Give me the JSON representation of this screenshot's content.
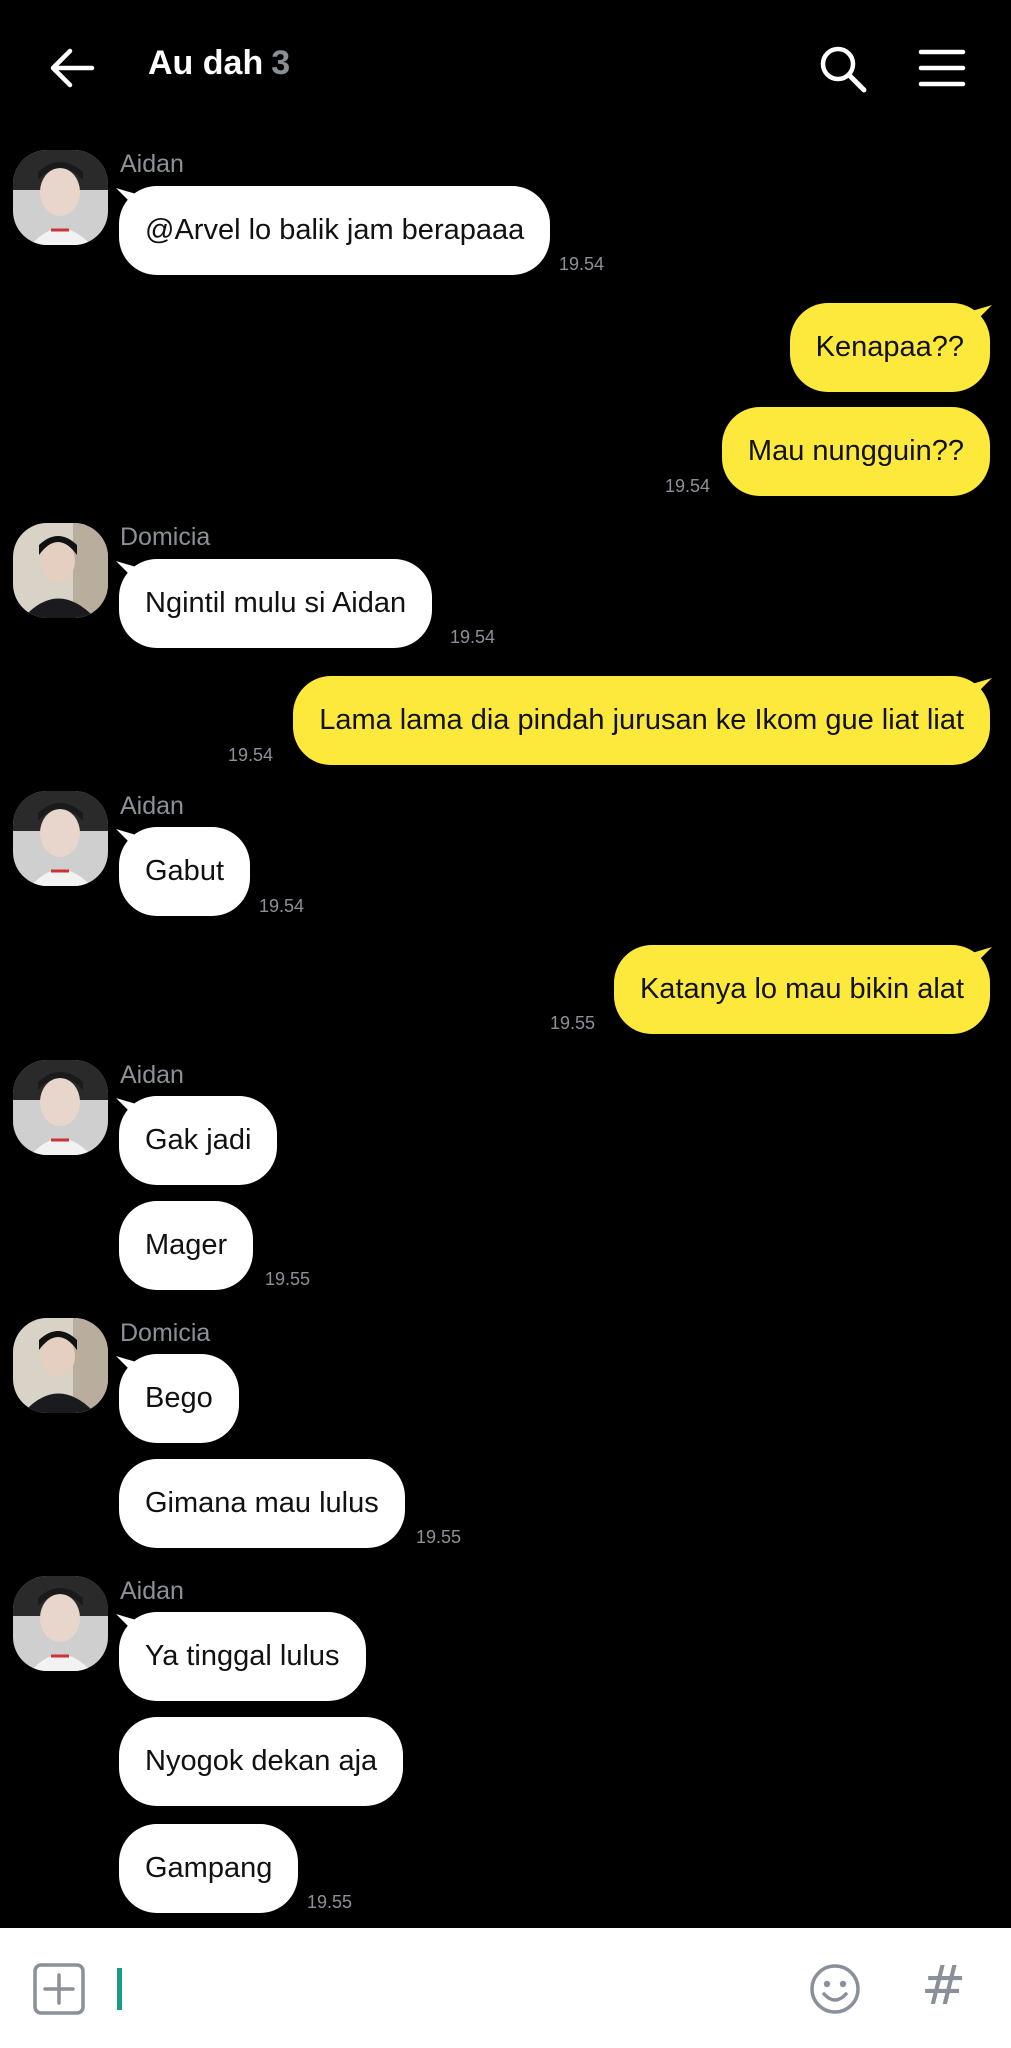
{
  "header": {
    "title": "Au dah",
    "member_count": "3"
  },
  "messages": {
    "m1_sender": "Aidan",
    "m1_text": "@Arvel lo balik jam berapaaa",
    "m1_time": "19.54",
    "m2_text": "Kenapaa??",
    "m3_text": "Mau nungguin??",
    "m3_time": "19.54",
    "m4_sender": "Domicia",
    "m4_text": "Ngintil mulu si Aidan",
    "m4_time": "19.54",
    "m5_text": "Lama lama dia pindah jurusan ke Ikom gue liat liat",
    "m5_time": "19.54",
    "m6_sender": "Aidan",
    "m6_text": "Gabut",
    "m6_time": "19.54",
    "m7_text": "Katanya lo mau bikin alat",
    "m7_time": "19.55",
    "m8_sender": "Aidan",
    "m8_text": "Gak jadi",
    "m9_text": "Mager",
    "m9_time": "19.55",
    "m10_sender": "Domicia",
    "m10_text": "Bego",
    "m11_text": "Gimana mau lulus",
    "m11_time": "19.55",
    "m12_sender": "Aidan",
    "m12_text": "Ya tinggal lulus",
    "m13_text": "Nyogok dekan aja",
    "m14_text": "Gampang",
    "m14_time": "19.55"
  },
  "input": {
    "hash_symbol": "#"
  },
  "colors": {
    "background": "#000000",
    "incoming_bubble": "#ffffff",
    "outgoing_bubble": "#fde93c",
    "timestamp": "#8c9099",
    "cursor": "#1a9c8a"
  },
  "icons": [
    "back-arrow-icon",
    "search-icon",
    "hamburger-menu-icon",
    "add-attachment-icon",
    "emoji-icon",
    "hashtag-icon",
    "avatar-aidan",
    "avatar-domicia"
  ]
}
